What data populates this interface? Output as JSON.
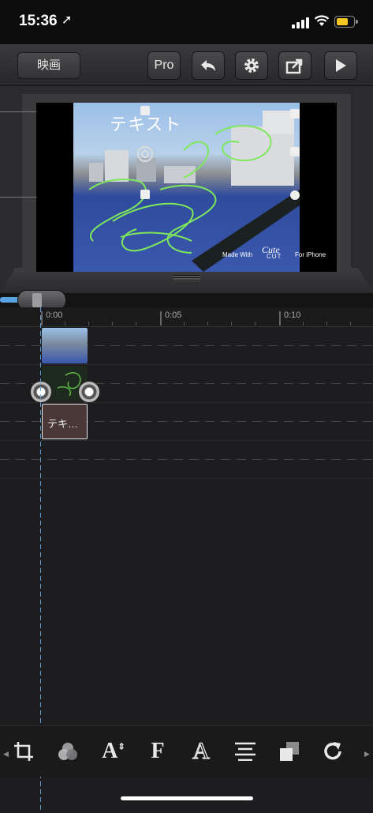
{
  "status_bar": {
    "time": "15:36",
    "location_arrow": "➚"
  },
  "toolbar": {
    "back_label": "映画",
    "pro_label": "Pro",
    "icons": [
      "undo-icon",
      "gear-icon",
      "share-icon",
      "play-icon"
    ]
  },
  "preview": {
    "overlay_text": "テキスト",
    "watermark_made_with": "Made With",
    "watermark_cute": "Cute",
    "watermark_cut": "CUT",
    "watermark_for": "For iPhone"
  },
  "timeline": {
    "ruler_labels": [
      "0:00",
      "0:05",
      "0:10"
    ],
    "text_clip_label": "テキ…"
  },
  "colors": {
    "accent": "#5aa3e0",
    "drawing": "#7ee85c",
    "battery": "#f3c623"
  },
  "bottom_tools": [
    "crop-icon",
    "color-blend-icon",
    "text-size-icon",
    "font-bold-icon",
    "font-outline-icon",
    "align-center-icon",
    "layer-order-icon",
    "redo-icon"
  ]
}
